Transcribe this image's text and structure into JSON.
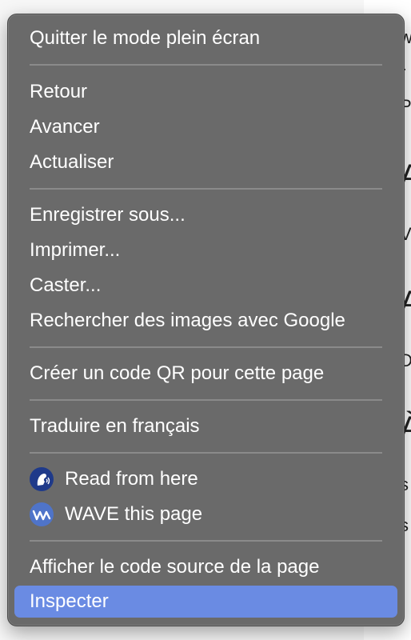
{
  "background_peek": [
    "w",
    "r",
    "P",
    "A",
    "V",
    "A",
    "D",
    "À",
    "s",
    "s"
  ],
  "menu": {
    "items": [
      {
        "label": "Quitter le mode plein écran"
      },
      {
        "label": "Retour"
      },
      {
        "label": "Avancer"
      },
      {
        "label": "Actualiser"
      },
      {
        "label": "Enregistrer sous..."
      },
      {
        "label": "Imprimer..."
      },
      {
        "label": "Caster..."
      },
      {
        "label": "Rechercher des images avec Google"
      },
      {
        "label": "Créer un code QR pour cette page"
      },
      {
        "label": "Traduire en français"
      },
      {
        "label": "Read from here",
        "icon": "read-aloud-icon"
      },
      {
        "label": "WAVE this page",
        "icon": "wave-icon"
      },
      {
        "label": "Afficher le code source de la page"
      },
      {
        "label": "Inspecter",
        "selected": true
      }
    ]
  },
  "colors": {
    "menu_bg": "#6a6a6a",
    "highlight": "#6a8be3",
    "text": "#ffffff",
    "separator": "#8a8a8a"
  }
}
